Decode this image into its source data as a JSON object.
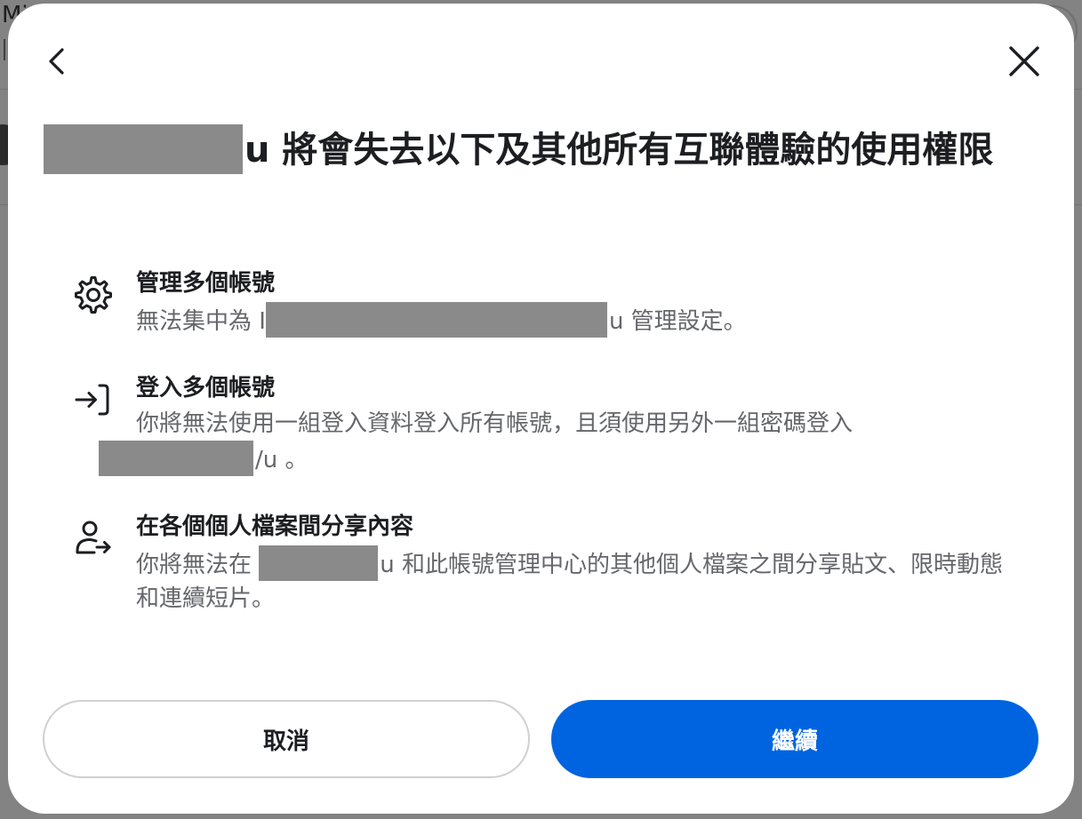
{
  "background": {
    "title_fragment": "Mi"
  },
  "modal": {
    "title_suffix": "u 將會失去以下及其他所有互聯體驗的使用權限",
    "items": [
      {
        "icon": "gear-icon",
        "title": "管理多個帳號",
        "desc_prefix": "無法集中為 I",
        "desc_suffix": "u 管理設定。"
      },
      {
        "icon": "login-arrow-icon",
        "title": "登入多個帳號",
        "desc_prefix": "你將無法使用一組登入資料登入所有帳號，且須使用另外一組密碼登入",
        "desc_suffix": "/u 。"
      },
      {
        "icon": "person-share-icon",
        "title": "在各個個人檔案間分享內容",
        "desc_prefix": "你將無法在 ",
        "desc_suffix": "u 和此帳號管理中心的其他個人檔案之間分享貼文、限時動態和連續短片。"
      }
    ],
    "cancel_label": "取消",
    "continue_label": "繼續"
  }
}
